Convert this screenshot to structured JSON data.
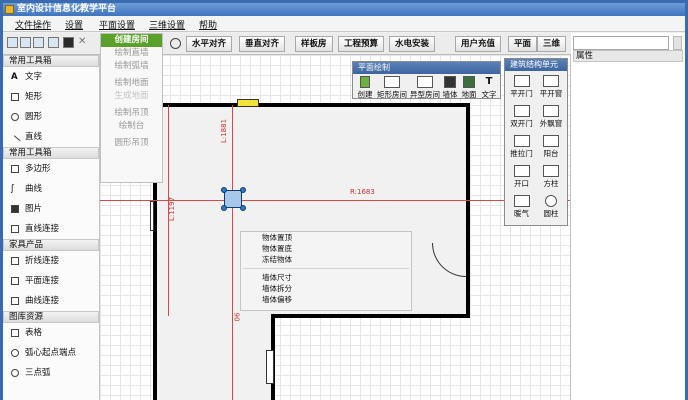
{
  "app": {
    "title": "室内设计信息化教学平台"
  },
  "menu": {
    "items": [
      "文件操作",
      "设置",
      "平面设置",
      "三维设置",
      "帮助"
    ]
  },
  "toolbar": {
    "buttons": [
      "水平对齐",
      "垂直对齐",
      "样板房",
      "工程预算",
      "水电安装",
      "用户充值",
      "平面",
      "三维"
    ]
  },
  "dropdown": {
    "items": [
      "创建房间",
      "绘制直墙",
      "绘制弧墙",
      "绘制地面",
      "生成地面",
      "绘制吊顶",
      "绘制台",
      "圆形吊顶"
    ]
  },
  "sidebar": {
    "sections": [
      {
        "title": "常用工具箱",
        "items": [
          "文字",
          "矩形",
          "圆形",
          "直线"
        ]
      },
      {
        "title": "常用工具箱",
        "items": [
          "多边形",
          "曲线",
          "图片",
          "直线连接"
        ]
      },
      {
        "title": "家具产品",
        "items": [
          "折线连接",
          "平面连接",
          "曲线连接"
        ]
      },
      {
        "title": "图库资源",
        "items": [
          "表格",
          "弧心起点端点",
          "三点弧"
        ]
      }
    ]
  },
  "canvas": {
    "dimensions": [
      "L:1881",
      "R:1683",
      "L:1197",
      "06"
    ]
  },
  "context_menu": {
    "items": [
      "物体置顶",
      "物体置底",
      "冻结物体",
      "墙体尺寸",
      "墙体拆分",
      "墙体偏移"
    ]
  },
  "plane_panel": {
    "title": "平面绘制",
    "items": [
      "创建",
      "矩形房间",
      "异型房间",
      "墙体",
      "地面",
      "文字"
    ]
  },
  "building_panel": {
    "title": "建筑结构单元",
    "items": [
      "平开门",
      "平开窗",
      "双开门",
      "外飘窗",
      "推拉门",
      "阳台",
      "开口",
      "方柱",
      "暖气",
      "圆柱"
    ]
  },
  "properties": {
    "title": "属性"
  },
  "colors": {
    "titlebar": "#3f74c0",
    "accent": "#5aa02a",
    "dimension": "#d24a4a"
  }
}
